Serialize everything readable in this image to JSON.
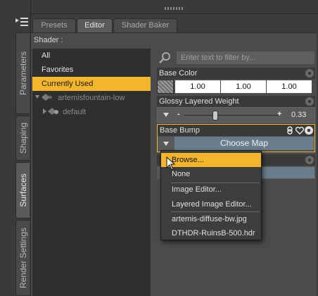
{
  "side_tabs": [
    "Parameters",
    "Shaping",
    "Surfaces",
    "Render Settings"
  ],
  "top_tabs": [
    "Presets",
    "Editor",
    "Shader Baker"
  ],
  "shader_label": "Shader :",
  "shader_list": {
    "items": [
      "All",
      "Favorites",
      "Currently Used"
    ],
    "selected": "Currently Used",
    "tree": {
      "parent": "artemisfountain-low",
      "child": "default"
    }
  },
  "filter": {
    "placeholder": "Enter text to filter by..."
  },
  "properties": {
    "base_color": {
      "label": "Base Color",
      "values": [
        "1.00",
        "1.00",
        "1.00"
      ]
    },
    "glossy_layered_weight": {
      "label": "Glossy Layered Weight",
      "minus": "-",
      "plus": "+",
      "value": "0.33",
      "level": 0.33
    },
    "base_bump": {
      "label": "Base Bump",
      "button": "Choose Map"
    }
  },
  "popup_menu": {
    "items": [
      "Browse...",
      "None",
      "Image Editor...",
      "Layered Image Editor...",
      "artemis-diffuse-bw.jpg",
      "DTHDR-RuinsB-500.hdr"
    ],
    "highlighted": "Browse..."
  },
  "colors": {
    "accent": "#f2b52c",
    "panel": "#4b4b4b",
    "list_bg": "#2f2f2f",
    "choose_map": "#6a7d8c"
  }
}
